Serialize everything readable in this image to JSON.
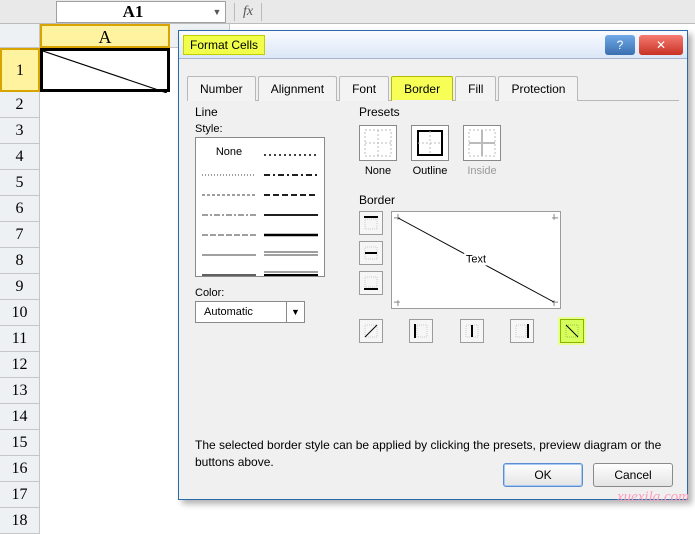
{
  "namebox": {
    "value": "A1"
  },
  "fx_label": "fx",
  "col_header": "A",
  "row_headers": [
    "1",
    "2",
    "3",
    "4",
    "5",
    "6",
    "7",
    "8",
    "9",
    "10",
    "11",
    "12",
    "13",
    "14",
    "15",
    "16",
    "17",
    "18"
  ],
  "cell_a1_diag": true,
  "dialog": {
    "title": "Format Cells",
    "help_icon": "?",
    "close_icon": "✕",
    "tabs": [
      "Number",
      "Alignment",
      "Font",
      "Border",
      "Fill",
      "Protection"
    ],
    "active_tab": "Border",
    "line": {
      "title": "Line",
      "style_label": "Style:",
      "none_label": "None"
    },
    "color": {
      "label": "Color:",
      "value": "Automatic"
    },
    "presets": {
      "title": "Presets",
      "items": [
        {
          "key": "none",
          "label": "None"
        },
        {
          "key": "outline",
          "label": "Outline"
        },
        {
          "key": "inside",
          "label": "Inside",
          "disabled": true
        }
      ]
    },
    "border": {
      "title": "Border",
      "preview_text": "Text"
    },
    "hint": "The selected border style can be applied by clicking the presets, preview diagram or the buttons above.",
    "buttons": {
      "ok": "OK",
      "cancel": "Cancel"
    }
  },
  "watermark": "xuexila.com"
}
